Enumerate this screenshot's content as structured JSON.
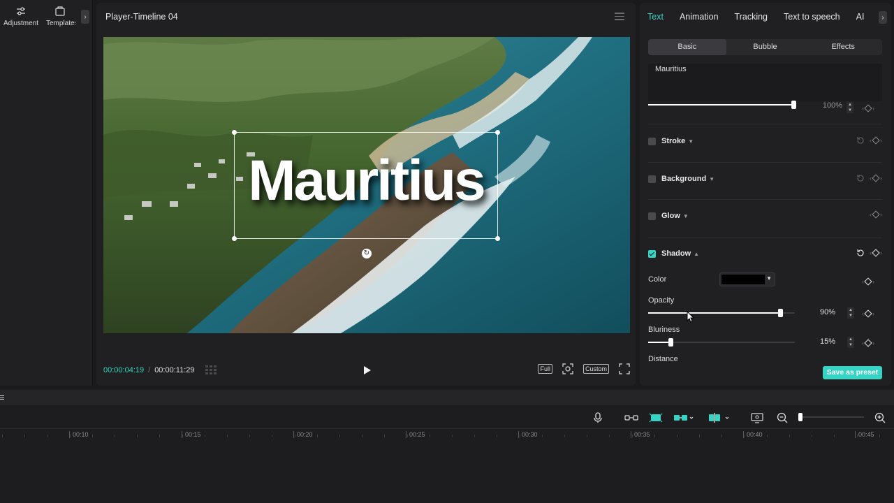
{
  "left_panel": {
    "tools": [
      {
        "label": "Adjustment",
        "icon": "sliders-icon"
      },
      {
        "label": "Templates",
        "icon": "template-icon"
      }
    ]
  },
  "player": {
    "title": "Player-Timeline 04",
    "overlay_text": "Mauritius",
    "time_current": "00:00:04:19",
    "time_separator": "/",
    "time_total": "00:00:11:29",
    "full_label": "Full",
    "custom_label": "Custom"
  },
  "inspector": {
    "tabs": [
      "Text",
      "Animation",
      "Tracking",
      "Text to speech",
      "AI"
    ],
    "active_tab": "Text",
    "segments": [
      "Basic",
      "Bubble",
      "Effects"
    ],
    "active_segment": "Basic",
    "text_value": "Mauritius",
    "top_slider_value": "100%",
    "top_slider_fraction": 1.0,
    "sections": [
      {
        "label": "Stroke",
        "checked": false
      },
      {
        "label": "Background",
        "checked": false
      },
      {
        "label": "Glow",
        "checked": false
      },
      {
        "label": "Shadow",
        "checked": true
      }
    ],
    "shadow": {
      "color_label": "Color",
      "color_value": "#000000",
      "opacity_label": "Opacity",
      "opacity_value": "90%",
      "opacity_fraction": 0.9,
      "blur_label": "Bluriness",
      "blur_value": "15%",
      "blur_fraction": 0.15,
      "distance_label": "Distance"
    },
    "save_preset_label": "Save as preset"
  },
  "timeline": {
    "ruler": [
      "00:10",
      "00:15",
      "00:20",
      "00:25",
      "00:30",
      "00:35",
      "00:40",
      "00:45"
    ]
  },
  "colors": {
    "accent": "#35d4c4",
    "panel": "#202022",
    "background": "#1a1a1c"
  }
}
